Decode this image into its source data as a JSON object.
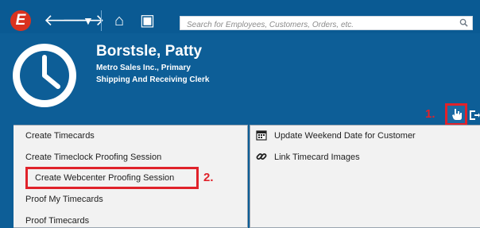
{
  "app": {
    "logo_letter": "E"
  },
  "toolbar": {
    "back_icon": "arrow-left-icon",
    "forward_icon": "arrow-right-icon",
    "history_icon": "dropdown-icon",
    "home_icon": "home-icon",
    "save_icon": "save-icon"
  },
  "search": {
    "placeholder": "Search for Employees, Customers, Orders, etc."
  },
  "employee": {
    "name": "Borstsle, Patty",
    "company": "Metro Sales Inc., Primary",
    "title": "Shipping And Receiving Clerk"
  },
  "annotations": {
    "step1": "1.",
    "step2": "2."
  },
  "left_menu": {
    "items": [
      "Create Timecards",
      "Create Timeclock Proofing Session",
      "Create Webcenter Proofing Session",
      "Proof My Timecards",
      "Proof Timecards"
    ]
  },
  "right_menu": {
    "items": [
      "Update Weekend Date for Customer",
      "Link Timecard Images"
    ]
  },
  "colors": {
    "header_bg": "#0d5e97",
    "annotation_red": "#e0222a",
    "logo_red": "#d9321f"
  }
}
